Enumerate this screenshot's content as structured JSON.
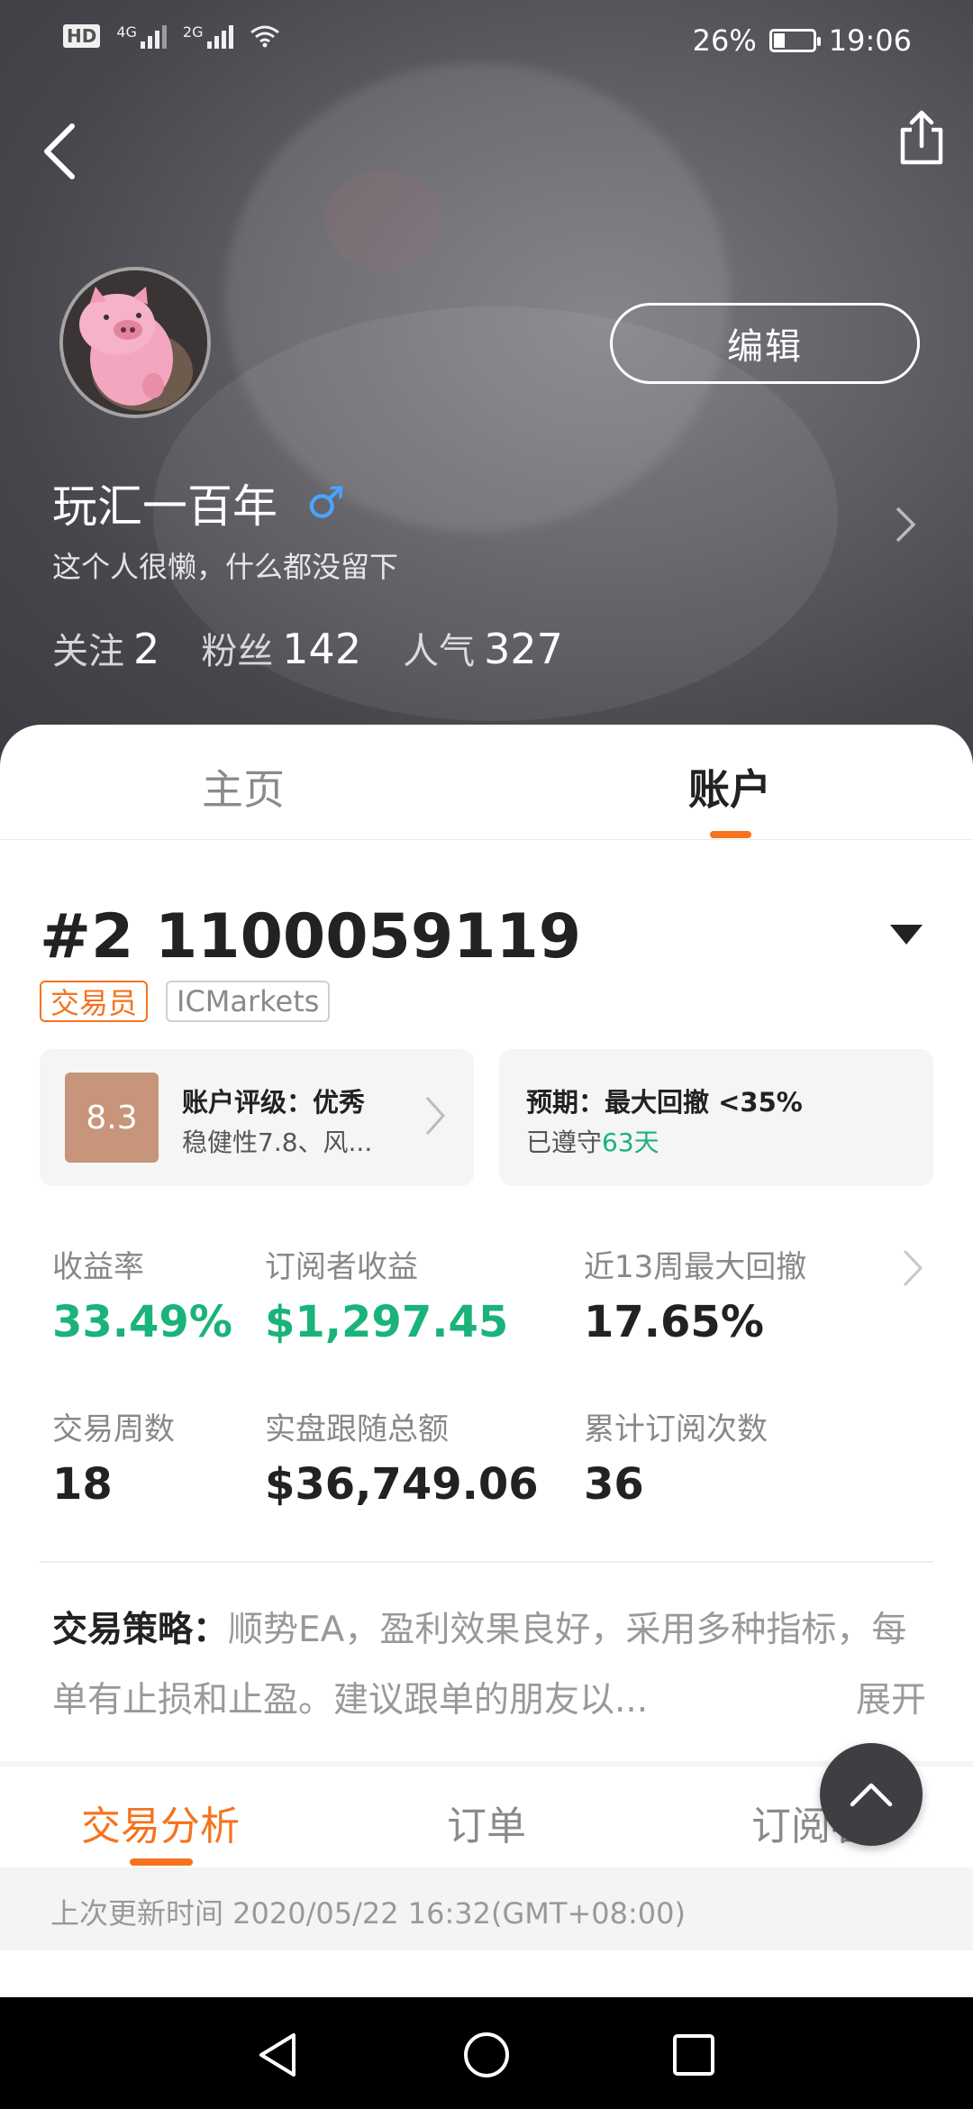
{
  "status_bar": {
    "left_icons": [
      "hd-icon",
      "4g-signal-icon",
      "2g-signal-icon",
      "wifi-icon"
    ],
    "hd_label": "HD",
    "net1_label": "4G",
    "net2_label": "2G",
    "battery_text": "26%",
    "battery_level": 0.26,
    "time": "19:06"
  },
  "header": {
    "edit_label": "编辑",
    "username": "玩汇一百年",
    "gender_symbol": "♂",
    "bio": "这个人很懒，什么都没留下",
    "stats": [
      {
        "label": "关注",
        "value": "2"
      },
      {
        "label": "粉丝",
        "value": "142"
      },
      {
        "label": "人气",
        "value": "327"
      }
    ]
  },
  "tabs": [
    {
      "label": "主页",
      "active": false
    },
    {
      "label": "账户",
      "active": true
    }
  ],
  "account": {
    "title": "#2 1100059119",
    "tags": [
      "交易员",
      "ICMarkets"
    ],
    "rating_card": {
      "score": "8.3",
      "title": "账户评级：优秀",
      "subtitle": "稳健性7.8、风..."
    },
    "expect_card": {
      "title": "预期：最大回撤 <35%",
      "subtitle_prefix": "已遵守",
      "subtitle_days": "63天"
    },
    "metrics": [
      {
        "label": "收益率",
        "value": "33.49%"
      },
      {
        "label": "订阅者收益",
        "value": "$1,297.45"
      },
      {
        "label": "近13周最大回撤",
        "value": "17.65%"
      },
      {
        "label": "交易周数",
        "value": "18"
      },
      {
        "label": "实盘跟随总额",
        "value": "$36,749.06"
      },
      {
        "label": "累计订阅次数",
        "value": "36"
      }
    ],
    "strategy_label": "交易策略：",
    "strategy_text": "顺势EA，盈利效果良好，采用多种指标，每单有止损和止盈。建议跟单的朋友以...",
    "expand_label": "展开"
  },
  "sub_tabs": [
    {
      "label": "交易分析",
      "active": true
    },
    {
      "label": "订单",
      "active": false
    },
    {
      "label": "订阅者",
      "active": false
    }
  ],
  "update_text": "上次更新时间 2020/05/22 16:32(GMT+08:00)",
  "colors": {
    "accent": "#f5731f",
    "positive": "#1ab37a",
    "score_bg": "#c7957b",
    "gender": "#4aa3ff"
  }
}
